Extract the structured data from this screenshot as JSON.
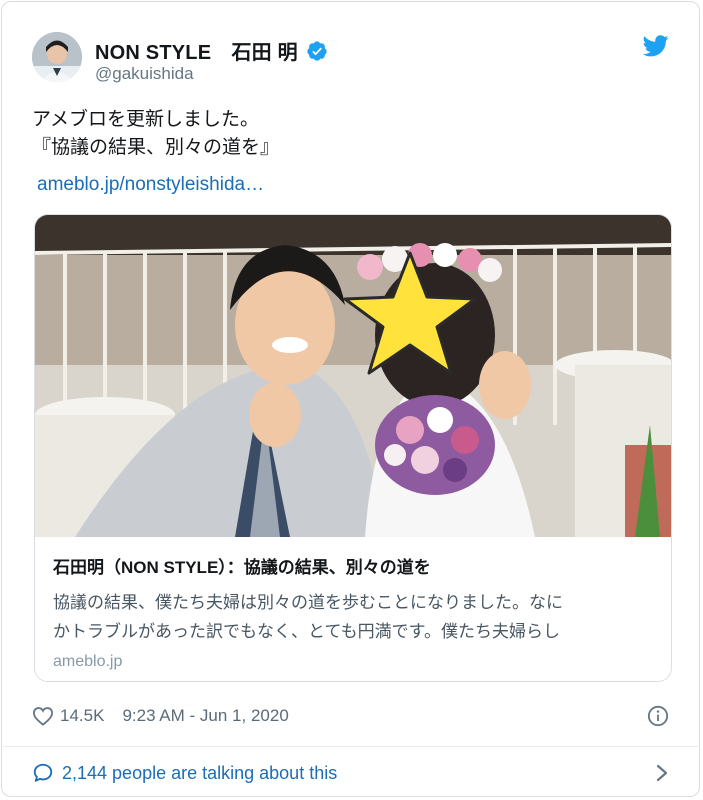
{
  "tweet": {
    "author_name": "NON STYLE　石田 明",
    "handle": "@gakuishida",
    "text_lines": [
      "アメブロを更新しました。",
      "『協議の結果、別々の道を』"
    ],
    "link_text": "ameblo.jp/nonstyleishida…",
    "like_count": "14.5K",
    "timestamp": "9:23 AM - Jun 1, 2020",
    "talking": "2,144 people are talking about this"
  },
  "link_card": {
    "title": "石田明（NON STYLE）：協議の結果、別々の道を",
    "description_lines": [
      "協議の結果、僕たち夫婦は別々の道を歩むことになりました。なに",
      "かトラブルがあった訳でもなく、とても円満です。僕たち夫婦らし"
    ],
    "domain": "ameblo.jp"
  },
  "colors": {
    "accent": "#1da1f2",
    "link": "#1b6db8",
    "star": "#ffe23b"
  },
  "icons": [
    "avatar",
    "verified-badge-icon",
    "twitter-bird-icon",
    "heart-icon",
    "info-icon",
    "speech-bubble-icon",
    "chevron-right-icon"
  ]
}
